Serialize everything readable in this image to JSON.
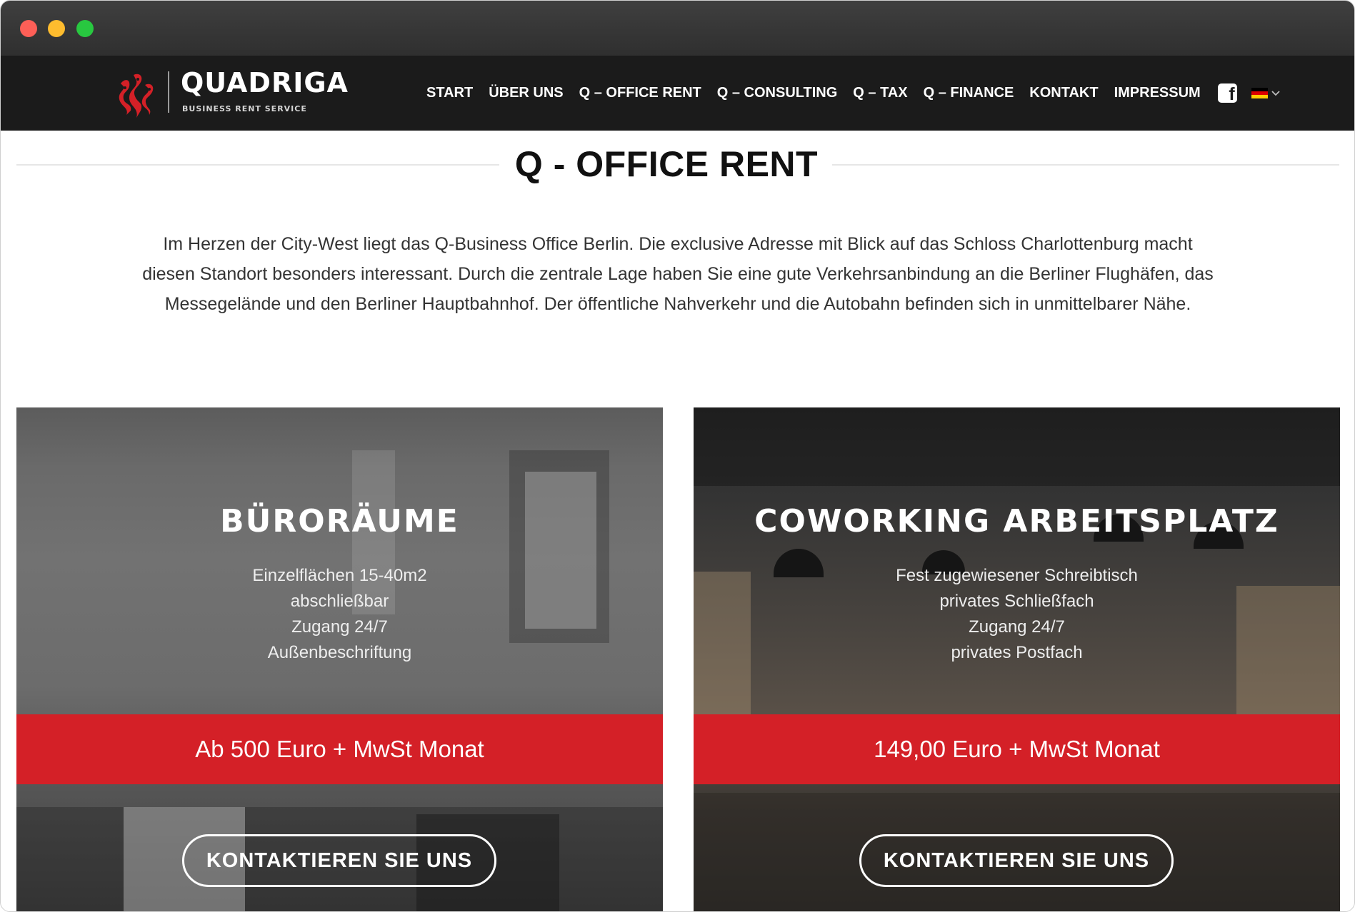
{
  "colors": {
    "header_bg": "#1b1b1b",
    "accent_red": "#d42027",
    "title_text": "#111111",
    "body_text": "#333333"
  },
  "logo": {
    "name": "QUADRIGA",
    "tagline": "BUSINESS RENT SERVICE"
  },
  "nav": {
    "items": [
      "START",
      "ÜBER UNS",
      "Q – OFFICE RENT",
      "Q – CONSULTING",
      "Q – TAX",
      "Q – FINANCE",
      "KONTAKT",
      "IMPRESSUM"
    ],
    "social_icon": "facebook-icon",
    "language_icon": "german-flag-icon"
  },
  "page": {
    "title": "Q - OFFICE RENT",
    "intro_lines": [
      "Im Herzen der City-West liegt das Q-Business Office Berlin. Die exclusive Adresse mit Blick auf das Schloss Charlottenburg macht",
      "diesen Standort besonders interessant. Durch die zentrale Lage haben Sie eine gute Verkehrsanbindung an die Berliner Flughäfen, das",
      "Messegelände und den Berliner Hauptbahnhof. Der öffentliche Nahverkehr und die Autobahn befinden sich in unmittelbarer Nähe."
    ]
  },
  "cards": [
    {
      "heading": "BÜRORÄUME",
      "features": [
        "Einzelflächen 15-40m2",
        "abschließbar",
        "Zugang 24/7",
        "Außenbeschriftung"
      ],
      "price": "Ab 500 Euro + MwSt Monat",
      "cta": "KONTAKTIEREN SIE UNS"
    },
    {
      "heading": "COWORKING ARBEITSPLATZ",
      "features": [
        "Fest zugewiesener Schreibtisch",
        "privates Schließfach",
        "Zugang 24/7",
        "privates Postfach"
      ],
      "price": "149,00 Euro + MwSt Monat",
      "cta": "KONTAKTIEREN SIE UNS"
    }
  ]
}
